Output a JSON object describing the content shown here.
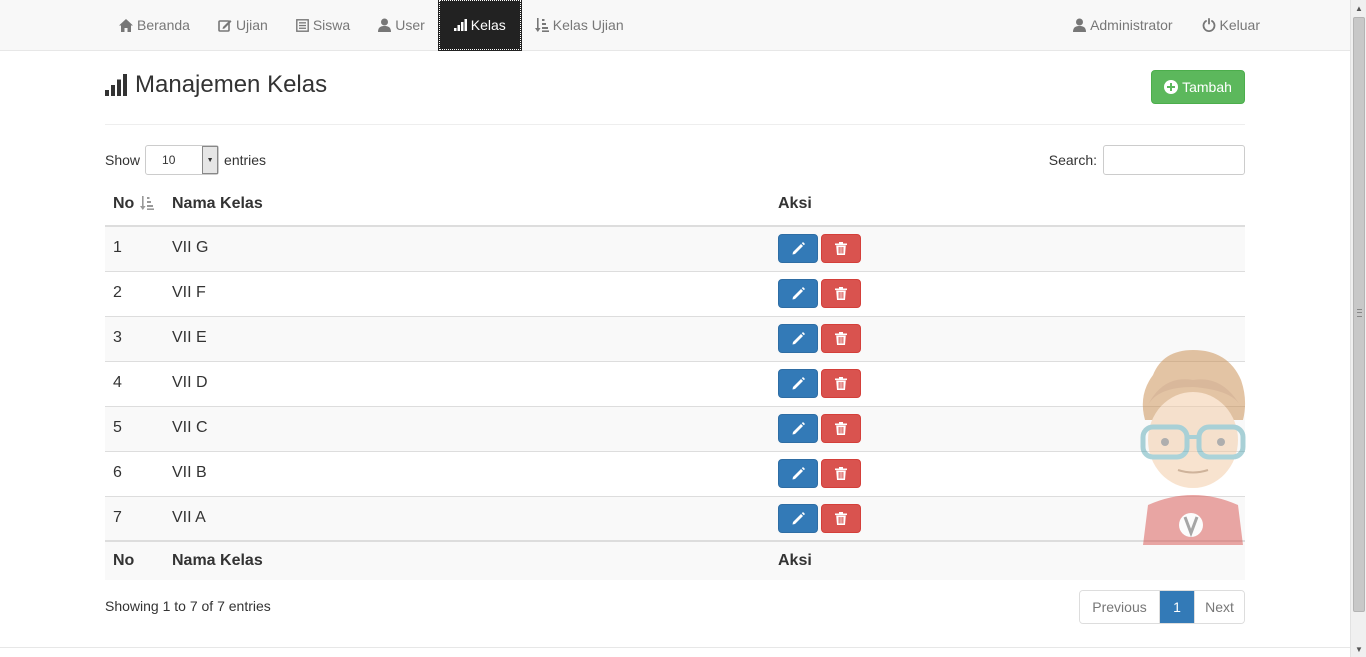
{
  "nav": {
    "items": [
      {
        "label": "Beranda",
        "icon": "home-icon"
      },
      {
        "label": "Ujian",
        "icon": "edit-icon"
      },
      {
        "label": "Siswa",
        "icon": "list-icon"
      },
      {
        "label": "User",
        "icon": "user-icon"
      },
      {
        "label": "Kelas",
        "icon": "signal-icon",
        "active": true
      },
      {
        "label": "Kelas Ujian",
        "icon": "sort-icon"
      }
    ],
    "right": [
      {
        "label": "Administrator",
        "icon": "user-icon"
      },
      {
        "label": "Keluar",
        "icon": "power-icon"
      }
    ]
  },
  "page": {
    "title": "Manajemen Kelas",
    "add_button": "Tambah"
  },
  "table_controls": {
    "show_label": "Show",
    "entries_value": "10",
    "entries_label": "entries",
    "search_label": "Search:",
    "search_value": ""
  },
  "table": {
    "columns": [
      "No",
      "Nama Kelas",
      "Aksi"
    ],
    "rows": [
      {
        "no": "1",
        "nama": "VII G"
      },
      {
        "no": "2",
        "nama": "VII F"
      },
      {
        "no": "3",
        "nama": "VII E"
      },
      {
        "no": "4",
        "nama": "VII D"
      },
      {
        "no": "5",
        "nama": "VII C"
      },
      {
        "no": "6",
        "nama": "VII B"
      },
      {
        "no": "7",
        "nama": "VII A"
      }
    ]
  },
  "footer": {
    "info": "Showing 1 to 7 of 7 entries",
    "previous": "Previous",
    "current_page": "1",
    "next": "Next"
  },
  "colors": {
    "primary": "#337ab7",
    "success": "#5cb85c",
    "danger": "#d9534f",
    "navbar_active": "#222222"
  }
}
